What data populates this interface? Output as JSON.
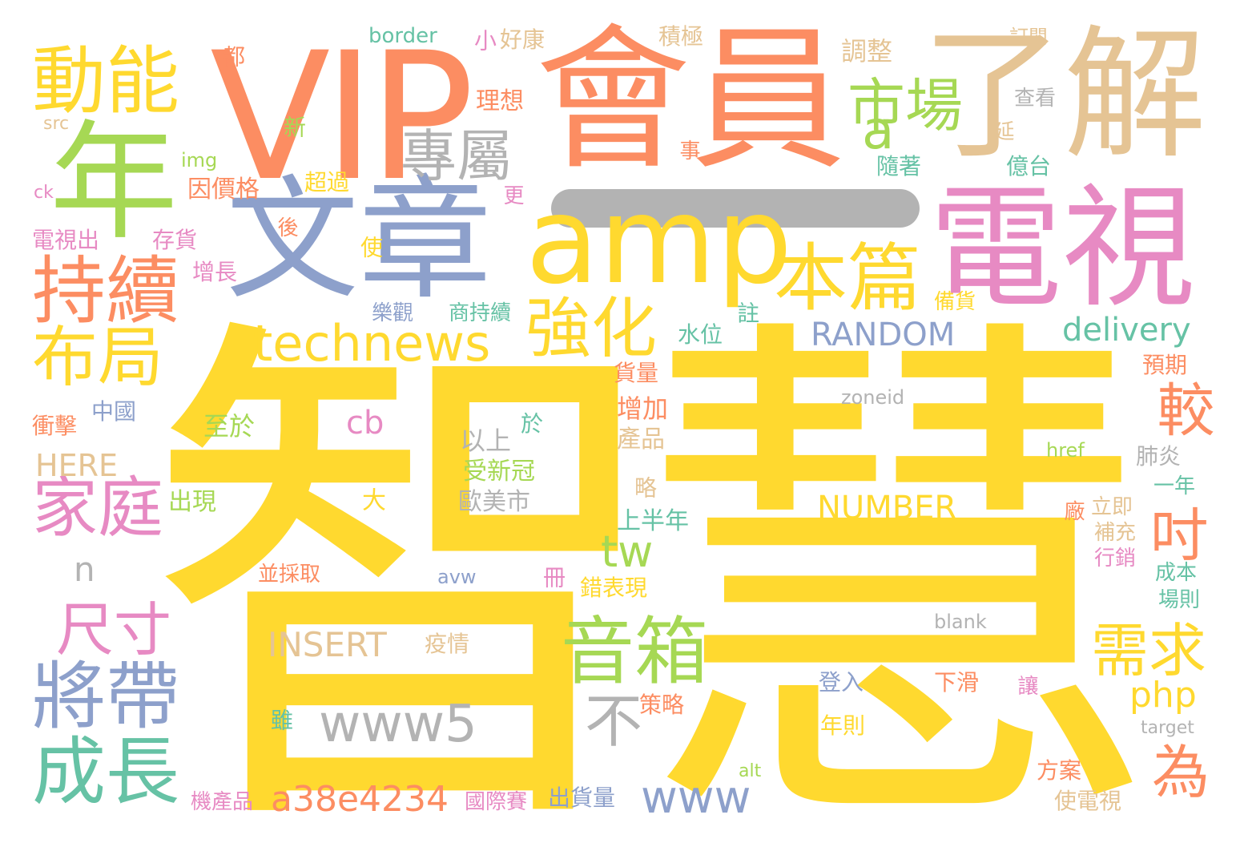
{
  "palette": {
    "yellow": "#ffd92f",
    "orange": "#fc8d62",
    "blue": "#8da0cb",
    "pink": "#e78ac3",
    "green": "#a6d854",
    "teal": "#66c2a5",
    "tan": "#e5c494",
    "gray": "#b3b3b3"
  },
  "words": [
    "智慧",
    "會員",
    "VIP",
    "了解",
    "文章",
    "電視",
    "amp",
    "年",
    "動能",
    "持續",
    "市場",
    "專屬",
    "a",
    "本篇",
    "強化",
    "technews",
    "布局",
    "RANDOM",
    "delivery",
    "較",
    "家庭",
    "cb",
    "HERE",
    "尺寸",
    "將帶",
    "成長",
    "tw",
    "吋",
    "NUMBER",
    "n",
    "音箱",
    "需求",
    "php",
    "不",
    "www5",
    "www",
    "為",
    "a38e4234",
    "INSERT",
    "border",
    "小",
    "好康",
    "積極",
    "調整",
    "訂閱",
    "都",
    "理想",
    "查看",
    "src",
    "新",
    "img",
    "事",
    "延",
    "億台",
    "隨著",
    "ck",
    "因價格",
    "超過",
    "更",
    "後",
    "電視出",
    "存貨",
    "使",
    "增長",
    "樂觀",
    "商持續",
    "註",
    "備貨",
    "水位",
    "貨量",
    "預期",
    "中國",
    "衝擊",
    "至於",
    "於",
    "以上",
    "增加",
    "zoneid",
    "產品",
    "受新冠",
    "肺炎",
    "href",
    "出現",
    "大",
    "歐美市",
    "略",
    "上半年",
    "一年",
    "立即",
    "廠",
    "補充",
    "行銷",
    "成本",
    "場則",
    "並採取",
    "avw",
    "冊",
    "錯表現",
    "blank",
    "疫情",
    "登入",
    "下滑",
    "讓",
    "策略",
    "雖",
    "target",
    "年則",
    "alt",
    "方案",
    "機產品",
    "國際賽",
    "出貨量",
    "使電視"
  ]
}
